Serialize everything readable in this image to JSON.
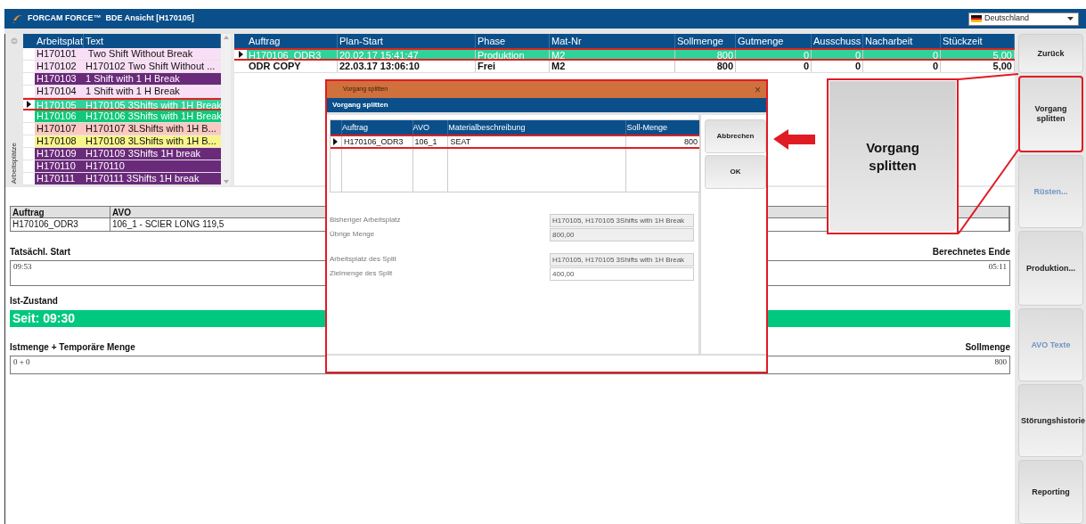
{
  "window": {
    "title": "FORCAM FORCE™  BDE Ansicht [H170105]",
    "language": "Deutschland"
  },
  "workplaces": {
    "side_label": "Arbeitsplätze",
    "columns": [
      "Arbeitsplat",
      "Text"
    ],
    "rows": [
      {
        "cells": [
          "H170101",
          " Two Shift Without Break"
        ],
        "color": "#f9dff5",
        "selected": false
      },
      {
        "cells": [
          "H170102",
          "H170102 Two Shift Without ..."
        ],
        "color": "#f9dff5",
        "selected": false
      },
      {
        "cells": [
          "H170103",
          "1 Shift with 1 H Break"
        ],
        "color": "#6a2a7a",
        "selected": false
      },
      {
        "cells": [
          "H170104",
          "1 Shift with 1 H Break"
        ],
        "color": "#f9dff5",
        "selected": false
      },
      {
        "cells": [
          "H170105",
          "H170105 3Shifts with 1H Break"
        ],
        "color": "#2fd39a",
        "selected": true
      },
      {
        "cells": [
          "H170106",
          "H170106 3Shifts with 1H Break"
        ],
        "color": "#10c87a",
        "selected": false
      },
      {
        "cells": [
          "H170107",
          "H170107 3LShifts with 1H B..."
        ],
        "color": "#fbc8c2",
        "selected": false
      },
      {
        "cells": [
          "H170108",
          "H170108 3LShifts with 1H B..."
        ],
        "color": "#f8f48c",
        "selected": false
      },
      {
        "cells": [
          "H170109",
          "H170109 3Shifts 1H break"
        ],
        "color": "#6a2a7a",
        "selected": false
      },
      {
        "cells": [
          "H170110",
          "H170110"
        ],
        "color": "#6a2a7a",
        "selected": false
      },
      {
        "cells": [
          "H170111",
          "H170111 3Shifts 1H break"
        ],
        "color": "#6a2a7a",
        "selected": false
      }
    ]
  },
  "orders": {
    "columns": [
      {
        "label": "Auftrag",
        "numeric": false
      },
      {
        "label": "Plan-Start",
        "numeric": false
      },
      {
        "label": "Phase",
        "numeric": false
      },
      {
        "label": "Mat-Nr",
        "numeric": false
      },
      {
        "label": "Sollmenge",
        "numeric": true
      },
      {
        "label": "Gutmenge",
        "numeric": true
      },
      {
        "label": "Ausschuss",
        "numeric": true
      },
      {
        "label": "Nacharbeit",
        "numeric": true
      },
      {
        "label": "Stückzeit",
        "numeric": true
      }
    ],
    "rows": [
      {
        "cells": [
          "H170106_ODR3",
          "20.02.17 15:41:47",
          "Produktion",
          "M2",
          "800",
          "0",
          "0",
          "0",
          "5,00"
        ],
        "selected": true
      },
      {
        "cells": [
          "ODR COPY",
          "22.03.17 13:06:10",
          "Frei",
          "M2",
          "800",
          "0",
          "0",
          "0",
          "5,00"
        ],
        "selected": false
      }
    ]
  },
  "current_operation": {
    "columns": [
      "Auftrag",
      "AVO"
    ],
    "values": [
      "H170106_ODR3",
      "106_1 - SCIER LONG 119,5"
    ]
  },
  "actual_start": {
    "label": "Tatsächl. Start",
    "value": "09:53"
  },
  "calculated_end": {
    "label": "Berechnetes Ende",
    "value": "05:11"
  },
  "status": {
    "label": "Ist-Zustand",
    "text": "Seit: 09:30",
    "color": "#00c97f"
  },
  "quantity": {
    "label": "Istmenge + Temporäre Menge",
    "value": "0 + 0"
  },
  "target_quantity": {
    "label": "Sollmenge",
    "value": "800"
  },
  "side_buttons": [
    {
      "label": "Zurück",
      "disabled": false,
      "highlighted": false
    },
    {
      "label": "Vorgang splitten",
      "disabled": false,
      "highlighted": true
    },
    {
      "label": "Rüsten...",
      "disabled": true,
      "highlighted": false
    },
    {
      "label": "Produktion...",
      "disabled": false,
      "highlighted": false
    },
    {
      "label": "AVO Texte",
      "disabled": true,
      "highlighted": false
    },
    {
      "label": "Störungshistorie",
      "disabled": false,
      "highlighted": false
    },
    {
      "label": "Reporting",
      "disabled": false,
      "highlighted": false
    }
  ],
  "dialog": {
    "title": "Vorgang splitten",
    "close": "×",
    "header": "Vorgang splitten",
    "columns": [
      {
        "label": "Auftrag",
        "numeric": false
      },
      {
        "label": "AVO",
        "numeric": false
      },
      {
        "label": "Materialbeschreibung",
        "numeric": false
      },
      {
        "label": "Soll-Menge",
        "numeric": true
      }
    ],
    "rows": [
      {
        "cells": [
          "H170106_ODR3",
          "106_1",
          "SEAT",
          "800"
        ],
        "selected": true
      }
    ],
    "buttons": [
      "Abbrechen",
      "OK"
    ],
    "fields": [
      {
        "label": "Bisheriger Arbeitsplatz",
        "value": "H170105, H170105 3Shifts with 1H Break",
        "readonly": true
      },
      {
        "label": "Übrige Menge",
        "value": "800,00",
        "readonly": true
      },
      {
        "label": "Arbeitsplatz des Split",
        "value": "H170105, H170105 3Shifts with 1H Break",
        "readonly": true
      },
      {
        "label": "Zielmenge des Split",
        "value": "400,00",
        "readonly": false
      }
    ]
  },
  "callout": {
    "label": "Vorgang splitten"
  }
}
